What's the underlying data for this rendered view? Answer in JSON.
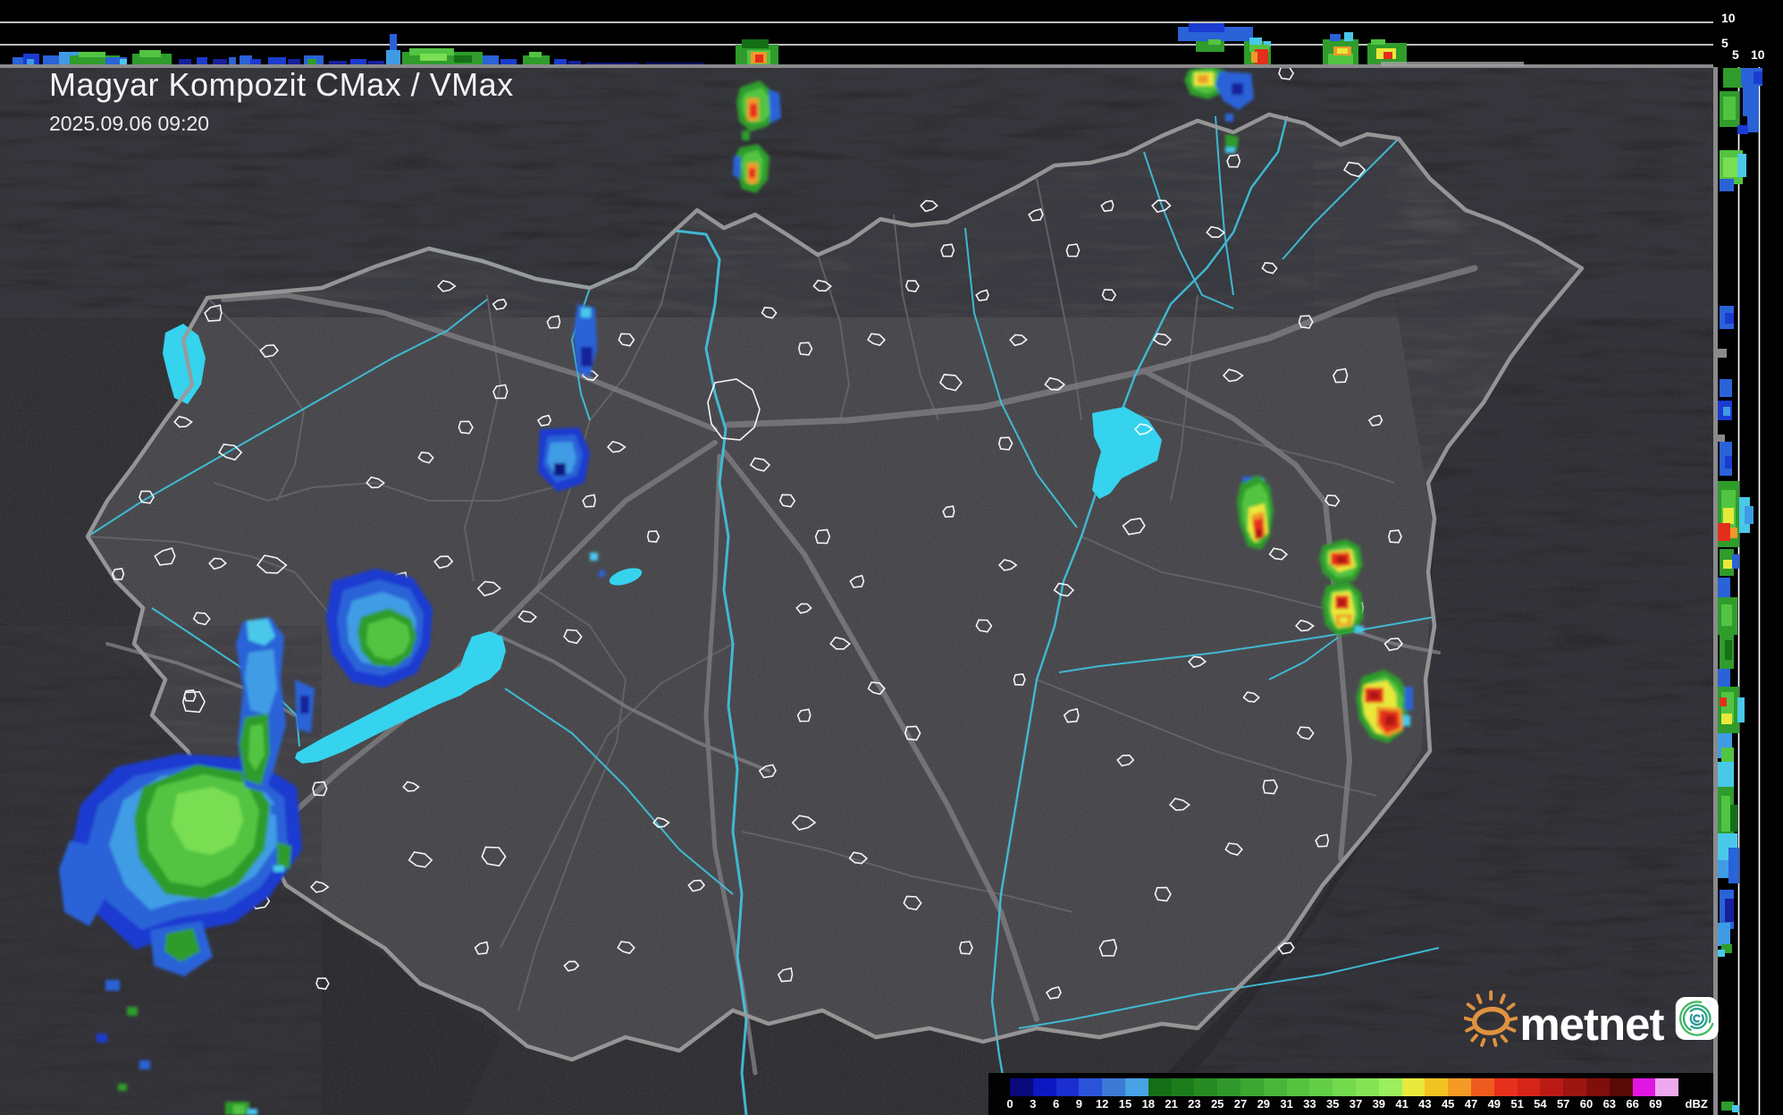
{
  "header": {
    "title": "Magyar Kompozit CMax / VMax",
    "timestamp": "2025.09.06 09:20"
  },
  "axes": {
    "top_strip": {
      "tick_10": "10",
      "tick_5": "5"
    },
    "right_strip": {
      "tick_5": "5",
      "tick_10": "10"
    }
  },
  "legend": {
    "unit": "dBZ",
    "values": [
      "0",
      "3",
      "6",
      "9",
      "12",
      "15",
      "18",
      "21",
      "23",
      "25",
      "27",
      "29",
      "31",
      "33",
      "35",
      "37",
      "39",
      "41",
      "43",
      "45",
      "47",
      "49",
      "51",
      "54",
      "57",
      "60",
      "63",
      "66",
      "69"
    ],
    "colors": [
      "#0a0a7d",
      "#0c17c4",
      "#1a2ed1",
      "#2b53da",
      "#3c7ad6",
      "#47a3e4",
      "#156f17",
      "#1d7d1d",
      "#278b24",
      "#31992b",
      "#3da732",
      "#49b539",
      "#55c340",
      "#63cf47",
      "#73da4e",
      "#85e455",
      "#9bee5c",
      "#e8e93b",
      "#f2c221",
      "#f39b24",
      "#ef5b1f",
      "#e7301b",
      "#d62418",
      "#bb1b14",
      "#9d1510",
      "#800f0b",
      "#5a0a07",
      "#e216e2",
      "#f0a9ee",
      "#9fe9ea"
    ]
  },
  "logo": {
    "text": "metnet"
  },
  "theme": {
    "strip_bg": "#000000",
    "map_inside": "#3e3e42",
    "map_outside": "#242428",
    "border_gray": "#9a9a9a",
    "river_cyan": "#3fc3de",
    "lake_cyan": "#35d3ee",
    "sun_orange": "#e0923e",
    "spiral_teal": "#2aa57c"
  }
}
